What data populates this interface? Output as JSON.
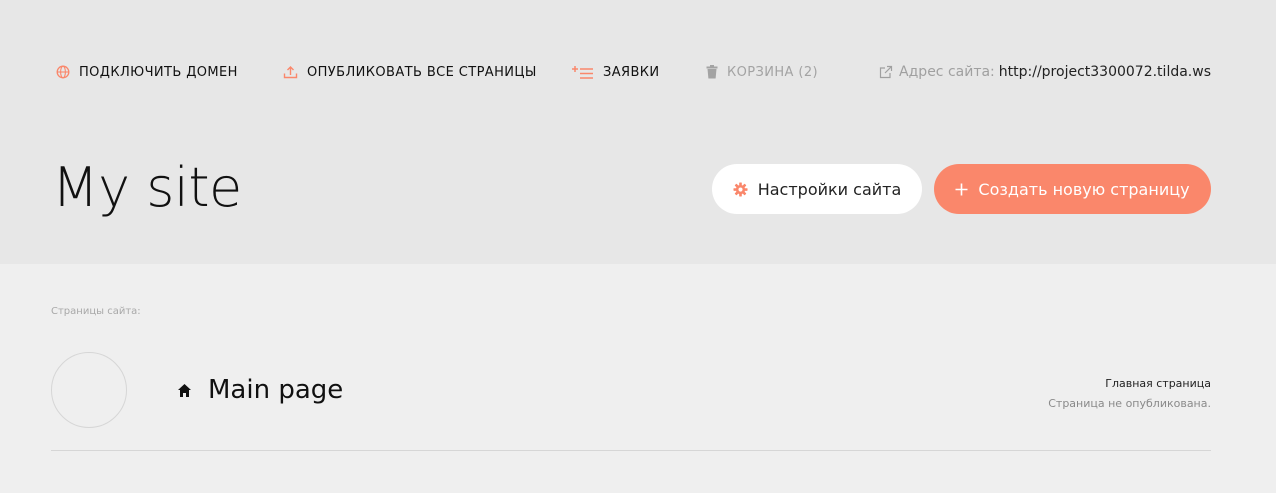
{
  "topbar": {
    "connect_domain": "ПОДКЛЮЧИТЬ ДОМЕН",
    "publish_all": "ОПУБЛИКОВАТЬ ВСЕ СТРАНИЦЫ",
    "requests": "ЗАЯВКИ",
    "trash": "КОРЗИНА (2)",
    "site_address_label": "Адрес сайта:",
    "site_address_url": "http://project3300072.tilda.ws"
  },
  "project": {
    "title": "My site",
    "settings_button": "Настройки сайта",
    "create_page_button": "Создать новую страницу"
  },
  "pages_section": {
    "label": "Страницы сайта:",
    "pages": [
      {
        "title": "Main page",
        "tag": "Главная страница",
        "status": "Страница не опубликована."
      }
    ]
  },
  "icons": {
    "connect_domain": "globe-icon",
    "publish_all": "upload-icon",
    "requests": "list-add-icon",
    "trash": "trash-icon",
    "site_address": "external-link-icon",
    "settings": "gear-icon",
    "create": "plus-icon",
    "home": "home-icon"
  },
  "colors": {
    "accent": "#fa876b",
    "header_bg": "#e7e7e7",
    "body_bg": "#efefef"
  }
}
